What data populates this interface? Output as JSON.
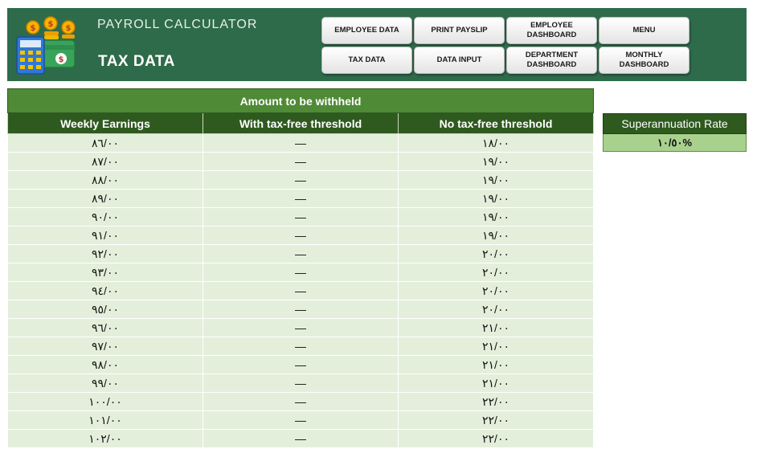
{
  "header": {
    "app_title": "PAYROLL CALCULATOR",
    "page_title": "TAX DATA",
    "nav": {
      "employee_data": "EMPLOYEE DATA",
      "print_payslip": "PRINT PAYSLIP",
      "employee_dashboard": "EMPLOYEE DASHBOARD",
      "menu": "MENU",
      "tax_data": "TAX DATA",
      "data_input": "DATA INPUT",
      "department_dashboard": "DEPARTMENT DASHBOARD",
      "monthly_dashboard": "MONTHLY DASHBOARD"
    }
  },
  "tax_table": {
    "title": "Amount to be withheld",
    "columns": [
      "Weekly Earnings",
      "With tax-free threshold",
      "No tax-free threshold"
    ],
    "rows": [
      [
        "٨٦/٠٠",
        "—",
        "١٨/٠٠"
      ],
      [
        "٨٧/٠٠",
        "—",
        "١٩/٠٠"
      ],
      [
        "٨٨/٠٠",
        "—",
        "١٩/٠٠"
      ],
      [
        "٨٩/٠٠",
        "—",
        "١٩/٠٠"
      ],
      [
        "٩٠/٠٠",
        "—",
        "١٩/٠٠"
      ],
      [
        "٩١/٠٠",
        "—",
        "١٩/٠٠"
      ],
      [
        "٩٢/٠٠",
        "—",
        "٢٠/٠٠"
      ],
      [
        "٩٣/٠٠",
        "—",
        "٢٠/٠٠"
      ],
      [
        "٩٤/٠٠",
        "—",
        "٢٠/٠٠"
      ],
      [
        "٩٥/٠٠",
        "—",
        "٢٠/٠٠"
      ],
      [
        "٩٦/٠٠",
        "—",
        "٢١/٠٠"
      ],
      [
        "٩٧/٠٠",
        "—",
        "٢١/٠٠"
      ],
      [
        "٩٨/٠٠",
        "—",
        "٢١/٠٠"
      ],
      [
        "٩٩/٠٠",
        "—",
        "٢١/٠٠"
      ],
      [
        "١٠٠/٠٠",
        "—",
        "٢٢/٠٠"
      ],
      [
        "١٠١/٠٠",
        "—",
        "٢٢/٠٠"
      ],
      [
        "١٠٢/٠٠",
        "—",
        "٢٢/٠٠"
      ]
    ]
  },
  "superannuation": {
    "label": "Superannuation Rate",
    "value": "١٠/٥٠%"
  },
  "icons": {
    "logo": "calculator-money-icon"
  },
  "colors": {
    "header_bg": "#2e6b4a",
    "table_title_bg": "#4f8a36",
    "table_header_bg": "#2f5a1f",
    "table_row_bg": "#e3efdb",
    "super_value_bg": "#a9d18e"
  }
}
